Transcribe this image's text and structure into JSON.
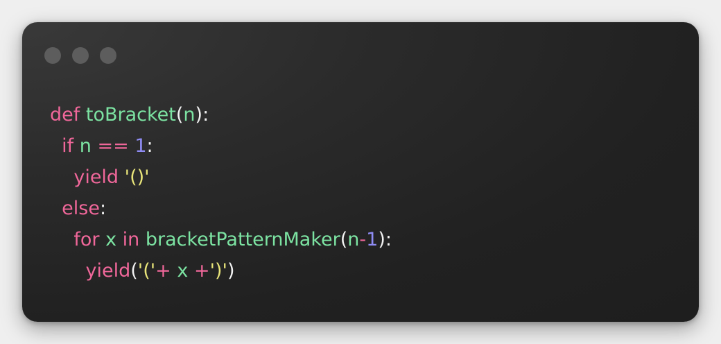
{
  "window": {
    "controls": [
      "window-dot",
      "window-dot",
      "window-dot"
    ]
  },
  "code": {
    "lines": [
      {
        "indent": "",
        "tokens": [
          {
            "t": "def",
            "c": "kw"
          },
          {
            "t": " ",
            "c": "punc"
          },
          {
            "t": "toBracket",
            "c": "fn"
          },
          {
            "t": "(",
            "c": "punc"
          },
          {
            "t": "n",
            "c": "var"
          },
          {
            "t": "):",
            "c": "punc"
          }
        ]
      },
      {
        "indent": "  ",
        "tokens": [
          {
            "t": "if",
            "c": "kw"
          },
          {
            "t": " ",
            "c": "punc"
          },
          {
            "t": "n",
            "c": "var"
          },
          {
            "t": " ",
            "c": "punc"
          },
          {
            "t": "==",
            "c": "op"
          },
          {
            "t": " ",
            "c": "punc"
          },
          {
            "t": "1",
            "c": "num"
          },
          {
            "t": ":",
            "c": "punc"
          }
        ]
      },
      {
        "indent": "    ",
        "tokens": [
          {
            "t": "yield",
            "c": "kw"
          },
          {
            "t": " ",
            "c": "punc"
          },
          {
            "t": "'()'",
            "c": "str"
          }
        ]
      },
      {
        "indent": "  ",
        "tokens": [
          {
            "t": "else",
            "c": "kw"
          },
          {
            "t": ":",
            "c": "punc"
          }
        ]
      },
      {
        "indent": "    ",
        "tokens": [
          {
            "t": "for",
            "c": "kw"
          },
          {
            "t": " ",
            "c": "punc"
          },
          {
            "t": "x",
            "c": "var"
          },
          {
            "t": " ",
            "c": "punc"
          },
          {
            "t": "in",
            "c": "kw"
          },
          {
            "t": " ",
            "c": "punc"
          },
          {
            "t": "bracketPatternMaker",
            "c": "fn"
          },
          {
            "t": "(",
            "c": "punc"
          },
          {
            "t": "n",
            "c": "var"
          },
          {
            "t": "-",
            "c": "op"
          },
          {
            "t": "1",
            "c": "num"
          },
          {
            "t": "):",
            "c": "punc"
          }
        ]
      },
      {
        "indent": "      ",
        "tokens": [
          {
            "t": "yield",
            "c": "kw"
          },
          {
            "t": "(",
            "c": "punc"
          },
          {
            "t": "'('",
            "c": "str"
          },
          {
            "t": "+",
            "c": "op"
          },
          {
            "t": " ",
            "c": "punc"
          },
          {
            "t": "x",
            "c": "var"
          },
          {
            "t": " ",
            "c": "punc"
          },
          {
            "t": "+",
            "c": "op"
          },
          {
            "t": "')'",
            "c": "str"
          },
          {
            "t": ")",
            "c": "punc"
          }
        ]
      }
    ]
  },
  "colors": {
    "keyword": "#f0679a",
    "function": "#7ce3a2",
    "number": "#8f8cf4",
    "string": "#e9e57a",
    "punctuation": "#f2f2f2"
  }
}
